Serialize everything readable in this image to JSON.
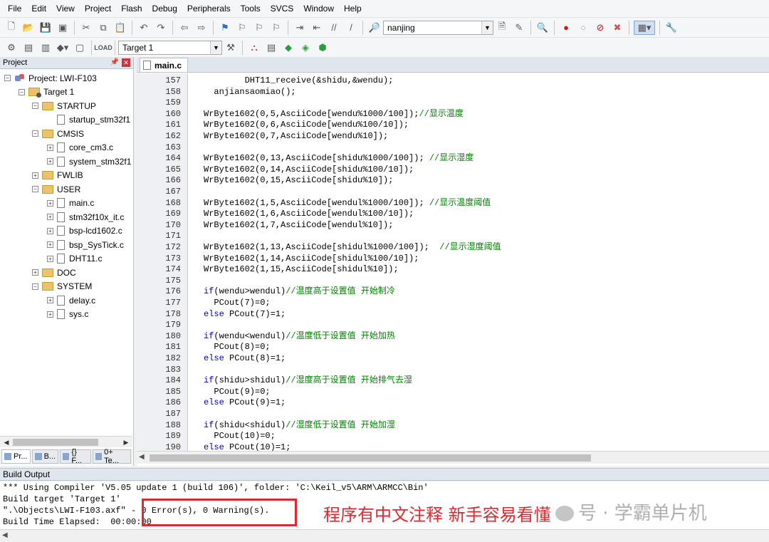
{
  "menu": [
    "File",
    "Edit",
    "View",
    "Project",
    "Flash",
    "Debug",
    "Peripherals",
    "Tools",
    "SVCS",
    "Window",
    "Help"
  ],
  "toolbar": {
    "find_combo": "nanjing",
    "target_combo": "Target 1"
  },
  "project": {
    "title": "Project",
    "tree": [
      {
        "label": "Project: LWI-F103",
        "level": 0,
        "type": "project",
        "exp": "-"
      },
      {
        "label": "Target 1",
        "level": 1,
        "type": "target",
        "exp": "-"
      },
      {
        "label": "STARTUP",
        "level": 2,
        "type": "folder",
        "exp": "-"
      },
      {
        "label": "startup_stm32f1",
        "level": 3,
        "type": "file",
        "exp": ""
      },
      {
        "label": "CMSIS",
        "level": 2,
        "type": "folder",
        "exp": "-"
      },
      {
        "label": "core_cm3.c",
        "level": 3,
        "type": "file",
        "exp": "+"
      },
      {
        "label": "system_stm32f1",
        "level": 3,
        "type": "file",
        "exp": "+"
      },
      {
        "label": "FWLIB",
        "level": 2,
        "type": "folder",
        "exp": "+"
      },
      {
        "label": "USER",
        "level": 2,
        "type": "folder",
        "exp": "-"
      },
      {
        "label": "main.c",
        "level": 3,
        "type": "file",
        "exp": "+"
      },
      {
        "label": "stm32f10x_it.c",
        "level": 3,
        "type": "file",
        "exp": "+"
      },
      {
        "label": "bsp-lcd1602.c",
        "level": 3,
        "type": "file",
        "exp": "+"
      },
      {
        "label": "bsp_SysTick.c",
        "level": 3,
        "type": "file",
        "exp": "+"
      },
      {
        "label": "DHT11.c",
        "level": 3,
        "type": "file",
        "exp": "+"
      },
      {
        "label": "DOC",
        "level": 2,
        "type": "folder",
        "exp": "+"
      },
      {
        "label": "SYSTEM",
        "level": 2,
        "type": "folder",
        "exp": "-"
      },
      {
        "label": "delay.c",
        "level": 3,
        "type": "file",
        "exp": "+"
      },
      {
        "label": "sys.c",
        "level": 3,
        "type": "file",
        "exp": "+"
      }
    ],
    "tabs": [
      "Pr...",
      "B...",
      "{} F...",
      "0+ Te..."
    ]
  },
  "editor": {
    "tab": "main.c",
    "lines": [
      {
        "n": "157",
        "code": "        DHT11_receive(&shidu,&wendu);",
        "cm": ""
      },
      {
        "n": "158",
        "code": "  anjiansaomiao();",
        "cm": ""
      },
      {
        "n": "159",
        "code": "",
        "cm": ""
      },
      {
        "n": "160",
        "code": "WrByte1602(0,5,AsciiCode[wendu%1000/100]);",
        "cm": "//显示温度"
      },
      {
        "n": "161",
        "code": "WrByte1602(0,6,AsciiCode[wendu%100/10]);",
        "cm": ""
      },
      {
        "n": "162",
        "code": "WrByte1602(0,7,AsciiCode[wendu%10]);",
        "cm": ""
      },
      {
        "n": "163",
        "code": "",
        "cm": ""
      },
      {
        "n": "164",
        "code": "WrByte1602(0,13,AsciiCode[shidu%1000/100]); ",
        "cm": "//显示湿度"
      },
      {
        "n": "165",
        "code": "WrByte1602(0,14,AsciiCode[shidu%100/10]);",
        "cm": ""
      },
      {
        "n": "166",
        "code": "WrByte1602(0,15,AsciiCode[shidu%10]);",
        "cm": ""
      },
      {
        "n": "167",
        "code": "",
        "cm": ""
      },
      {
        "n": "168",
        "code": "WrByte1602(1,5,AsciiCode[wendul%1000/100]); ",
        "cm": "//显示温度阈值"
      },
      {
        "n": "169",
        "code": "WrByte1602(1,6,AsciiCode[wendul%100/10]);",
        "cm": ""
      },
      {
        "n": "170",
        "code": "WrByte1602(1,7,AsciiCode[wendul%10]);",
        "cm": ""
      },
      {
        "n": "171",
        "code": "",
        "cm": ""
      },
      {
        "n": "172",
        "code": "WrByte1602(1,13,AsciiCode[shidul%1000/100]);  ",
        "cm": "//显示湿度阈值"
      },
      {
        "n": "173",
        "code": "WrByte1602(1,14,AsciiCode[shidul%100/10]);",
        "cm": ""
      },
      {
        "n": "174",
        "code": "WrByte1602(1,15,AsciiCode[shidul%10]);",
        "cm": ""
      },
      {
        "n": "175",
        "code": "",
        "cm": ""
      },
      {
        "n": "176",
        "kw": "if",
        "code": "(wendu>wendul)",
        "cm": "//温度高于设置值 开始制冷"
      },
      {
        "n": "177",
        "code": "  PCout(7)=0;",
        "cm": ""
      },
      {
        "n": "178",
        "kw": "else",
        "code": " PCout(7)=1;",
        "cm": ""
      },
      {
        "n": "179",
        "code": "",
        "cm": ""
      },
      {
        "n": "180",
        "kw": "if",
        "code": "(wendu<wendul)",
        "cm": "//温度低于设置值 开始加热"
      },
      {
        "n": "181",
        "code": "  PCout(8)=0;",
        "cm": ""
      },
      {
        "n": "182",
        "kw": "else",
        "code": " PCout(8)=1;",
        "cm": ""
      },
      {
        "n": "183",
        "code": "",
        "cm": ""
      },
      {
        "n": "184",
        "kw": "if",
        "code": "(shidu>shidul)",
        "cm": "//湿度高于设置值 开始排气去湿"
      },
      {
        "n": "185",
        "code": "  PCout(9)=0;",
        "cm": ""
      },
      {
        "n": "186",
        "kw": "else",
        "code": " PCout(9)=1;",
        "cm": ""
      },
      {
        "n": "187",
        "code": "",
        "cm": ""
      },
      {
        "n": "188",
        "kw": "if",
        "code": "(shidu<shidul)",
        "cm": "//湿度低于设置值 开始加湿"
      },
      {
        "n": "189",
        "code": "  PCout(10)=0;",
        "cm": ""
      },
      {
        "n": "190",
        "kw": "else",
        "code": " PCout(10)=1;",
        "cm": ""
      }
    ]
  },
  "build_output": {
    "title": "Build Output",
    "lines": [
      "*** Using Compiler 'V5.05 update 1 (build 106)', folder: 'C:\\Keil_v5\\ARM\\ARMCC\\Bin'",
      "Build target 'Target 1'",
      "\".\\Objects\\LWI-F103.axf\" - 0 Error(s), 0 Warning(s).",
      "Build Time Elapsed:  00:00:00"
    ]
  },
  "annotation": "程序有中文注释 新手容易看懂",
  "watermark": "号 · 学霸单片机",
  "colors": {
    "keyword": "#0000d0",
    "comment": "#008000",
    "highlight": "#e0282e"
  }
}
